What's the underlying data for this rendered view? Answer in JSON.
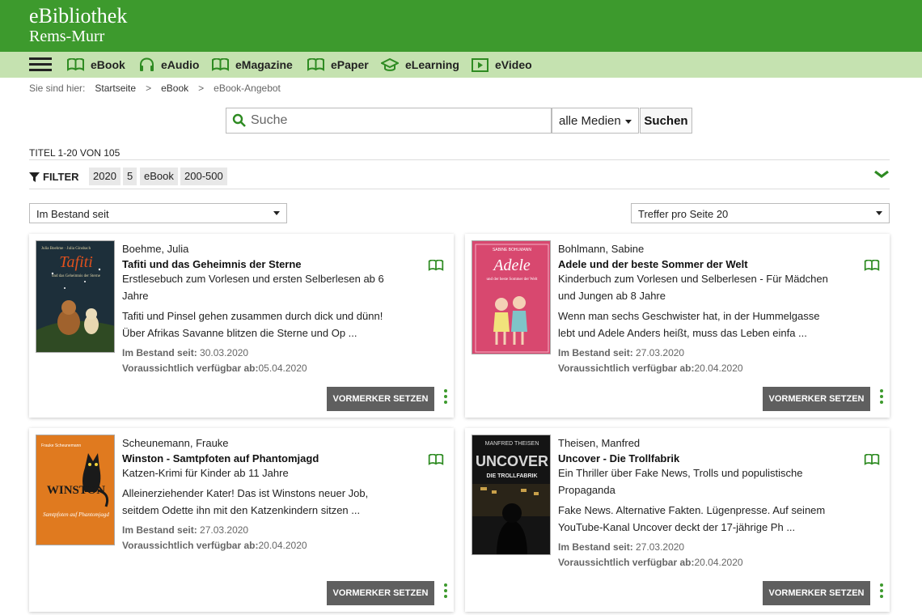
{
  "brand": {
    "title": "eBibliothek",
    "subtitle": "Rems-Murr"
  },
  "nav": {
    "items": [
      {
        "label": "eBook",
        "icon": "open-book-icon"
      },
      {
        "label": "eAudio",
        "icon": "headphones-icon"
      },
      {
        "label": "eMagazine",
        "icon": "open-book-icon"
      },
      {
        "label": "ePaper",
        "icon": "open-book-icon"
      },
      {
        "label": "eLearning",
        "icon": "graduation-cap-icon"
      },
      {
        "label": "eVideo",
        "icon": "play-icon"
      }
    ]
  },
  "breadcrumb": {
    "prefix": "Sie sind hier:",
    "items": [
      "Startseite",
      "eBook",
      "eBook-Angebot"
    ],
    "separator": ">"
  },
  "search": {
    "placeholder": "Suche",
    "media_select": "alle Medien",
    "button": "Suchen"
  },
  "results": {
    "count_text": "TITEL 1-20 VON 105"
  },
  "filter": {
    "label": "FILTER",
    "chips": [
      "2020",
      "5",
      "eBook",
      "200-500"
    ]
  },
  "sort": {
    "left": "Im Bestand seit",
    "right": "Treffer pro Seite 20"
  },
  "colors": {
    "brand_green": "#3d9a2d",
    "nav_light_green": "#c5e2b0",
    "button_gray": "#5f5f5f"
  },
  "books": [
    {
      "author": "Boehme, Julia",
      "title": "Tafiti und das Geheimnis der Sterne",
      "subtitle": "Erstlesebuch zum Vorlesen und ersten Selberlesen ab 6 Jahre",
      "desc": "Tafiti und Pinsel gehen zusammen durch dick und dünn! Über Afrikas Savanne blitzen die Sterne und Op ...",
      "stock_label": "Im Bestand seit:",
      "stock_date": "30.03.2020",
      "avail_label": "Voraussichtlich verfügbar ab:",
      "avail_date": "05.04.2020",
      "action": "VORMERKER SETZEN",
      "cover": {
        "top_text": "Julia Boehme · Julia Ginsbach",
        "big": "Tafiti",
        "small": "und das Geheimnis der Sterne",
        "bg": "#1c2b36"
      }
    },
    {
      "author": "Bohlmann, Sabine",
      "title": "Adele und der beste Sommer der Welt",
      "subtitle": "Kinderbuch zum Vorlesen und Selberlesen - Für Mädchen und Jungen ab 8 Jahre",
      "desc": "Wenn man sechs Geschwister hat, in der Hummelgasse lebt und Adele Anders heißt, muss das Leben einfa ...",
      "stock_label": "Im Bestand seit:",
      "stock_date": "27.03.2020",
      "avail_label": "Voraussichtlich verfügbar ab:",
      "avail_date": "20.04.2020",
      "action": "VORMERKER SETZEN",
      "cover": {
        "top_text": "SABINE BOHLMANN",
        "big": "Adele",
        "small": "und der beste Sommer der Welt",
        "bg": "#d6476f"
      }
    },
    {
      "author": "Scheunemann, Frauke",
      "title": "Winston - Samtpfoten auf Phantomjagd",
      "subtitle": "Katzen-Krimi für Kinder ab 11 Jahre",
      "desc": "Alleinerziehender Kater! Das ist Winstons neuer Job, seitdem Odette ihn mit den Katzenkindern sitzen ...",
      "stock_label": "Im Bestand seit:",
      "stock_date": "27.03.2020",
      "avail_label": "Voraussichtlich verfügbar ab:",
      "avail_date": "20.04.2020",
      "action": "VORMERKER SETZEN",
      "cover": {
        "top_text": "Frauke Scheunemann",
        "big": "WINSTON",
        "small": "Samtpfoten auf Phantomjagd",
        "bg": "#e07a1f"
      }
    },
    {
      "author": "Theisen, Manfred",
      "title": "Uncover - Die Trollfabrik",
      "subtitle": "Ein Thriller über Fake News, Trolls und populistische Propaganda",
      "desc": "Fake News. Alternative Fakten. Lügenpresse. Auf seinem YouTube-Kanal Uncover deckt der 17-jährige Ph ...",
      "stock_label": "Im Bestand seit:",
      "stock_date": "27.03.2020",
      "avail_label": "Voraussichtlich verfügbar ab:",
      "avail_date": "20.04.2020",
      "action": "VORMERKER SETZEN",
      "cover": {
        "top_text": "MANFRED THEISEN",
        "big": "UNCOVER",
        "small": "DIE TROLLFABRIK",
        "bg": "#141414"
      }
    }
  ]
}
